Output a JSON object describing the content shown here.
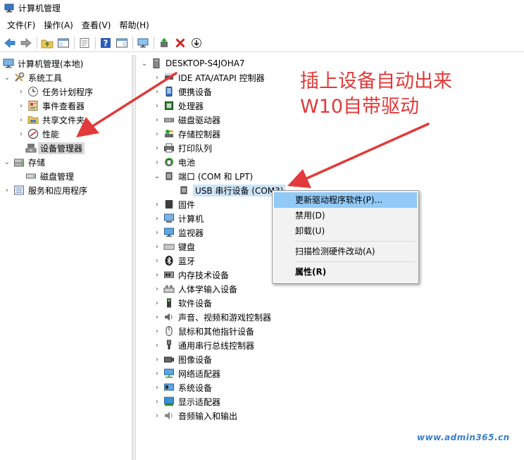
{
  "window": {
    "title": "计算机管理"
  },
  "menu": [
    {
      "label": "文件(F)"
    },
    {
      "label": "操作(A)"
    },
    {
      "label": "查看(V)"
    },
    {
      "label": "帮助(H)"
    }
  ],
  "toolbar": {
    "icons": [
      "back-arrow-icon",
      "forward-arrow-icon",
      "up-folder-icon",
      "show-hide-tree-icon",
      "properties-icon",
      "help-icon",
      "action-pane-icon",
      "monitor-icon",
      "update-driver-icon",
      "uninstall-x-icon",
      "download-icon"
    ]
  },
  "tree": {
    "root": "计算机管理(本地)",
    "system_tools": "系统工具",
    "task_scheduler": "任务计划程序",
    "event_viewer": "事件查看器",
    "shared_folders": "共享文件夹",
    "performance": "性能",
    "device_manager": "设备管理器",
    "storage": "存储",
    "disk_management": "磁盘管理",
    "services_apps": "服务和应用程序"
  },
  "devices": {
    "computer": "DESKTOP-S4JOHA7",
    "categories": [
      "IDE ATA/ATAPI 控制器",
      "便携设备",
      "处理器",
      "磁盘驱动器",
      "存储控制器",
      "打印队列",
      "电池",
      "端口 (COM 和 LPT)",
      "USB 串行设备 (COM3)",
      "固件",
      "计算机",
      "监视器",
      "键盘",
      "蓝牙",
      "内存技术设备",
      "人体学输入设备",
      "软件设备",
      "声音、视频和游戏控制器",
      "鼠标和其他指针设备",
      "通用串行总线控制器",
      "图像设备",
      "网络适配器",
      "系统设备",
      "显示适配器",
      "音频输入和输出"
    ]
  },
  "context_menu": {
    "update_driver": "更新驱动程序软件(P)...",
    "disable": "禁用(D)",
    "uninstall": "卸载(U)",
    "scan": "扫描检测硬件改动(A)",
    "properties": "属性(R)"
  },
  "annotation": {
    "line1": "插上设备自动出来",
    "line2": "W10自带驱动",
    "color": "#e23a3a"
  },
  "watermark": "www.admin365.cn"
}
